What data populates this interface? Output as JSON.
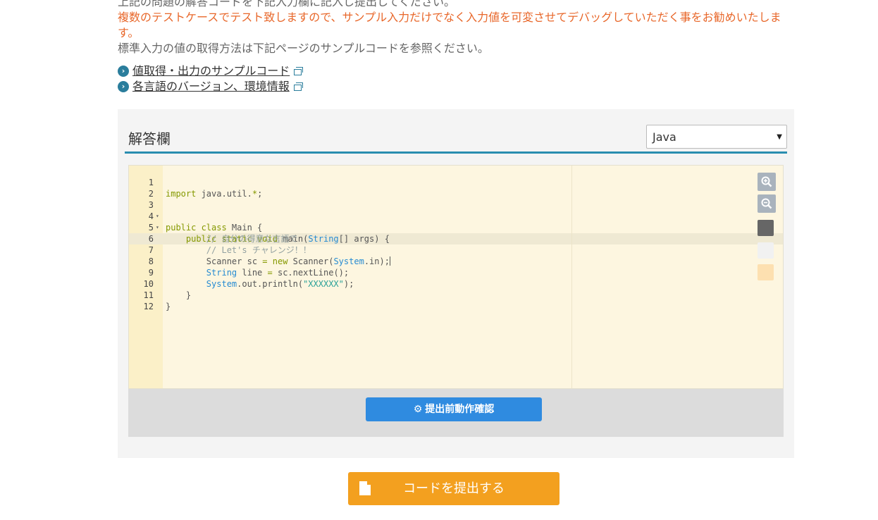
{
  "intro": {
    "line1": "上記の問題の解答コードを下記入力欄に記入し提出してください。",
    "line2": "複数のテストケースでテスト致しますので、サンプル入力だけでなく入力値を可変させてデバッグしていただく事をお勧めいたします。",
    "line3": "標準入力の値の取得方法は下記ページのサンプルコードを参照ください。"
  },
  "links": [
    {
      "label": "値取得・出力のサンプルコード",
      "icon": "external-link-icon"
    },
    {
      "label": "各言語のバージョン、環境情報",
      "icon": "external-link-icon"
    }
  ],
  "answer": {
    "title": "解答欄",
    "language": "Java"
  },
  "editor": {
    "lines": [
      {
        "n": "1",
        "fold": ""
      },
      {
        "n": "2",
        "fold": ""
      },
      {
        "n": "3",
        "fold": "▾"
      },
      {
        "n": "4",
        "fold": "▾"
      },
      {
        "n": "5",
        "fold": ""
      },
      {
        "n": "6",
        "fold": ""
      },
      {
        "n": "7",
        "fold": ""
      },
      {
        "n": "8",
        "fold": ""
      },
      {
        "n": "9",
        "fold": ""
      },
      {
        "n": "10",
        "fold": ""
      },
      {
        "n": "11",
        "fold": ""
      },
      {
        "n": "12",
        "fold": ""
      }
    ],
    "code": {
      "l1_kw": "import",
      "l1_rest": " java.util.",
      "l1_star": "*",
      "l1_end": ";",
      "l3_kw": "public class",
      "l3_rest": " Main {",
      "l4_kw": "public static void",
      "l4_mid": " main(",
      "l4_type": "String",
      "l4_rest": "[] args) {",
      "l5_cm": "// 自分の得意な言語で",
      "l6_cm": "// Let's チャレンジ！！",
      "l7_a": "Scanner sc ",
      "l7_op": "=",
      "l7_new": " new",
      "l7_b": " Scanner(",
      "l7_type": "System",
      "l7_c": ".in);",
      "l8_type": "String",
      "l8_a": " line ",
      "l8_op": "=",
      "l8_b": " sc.nextLine();",
      "l9_type": "System",
      "l9_a": ".out.println(",
      "l9_str": "\"XXXXXX\"",
      "l9_b": ");",
      "l10": "}",
      "l11": "}"
    }
  },
  "buttons": {
    "run_label": "提出前動作確認",
    "submit_label": "コードを提出する"
  },
  "colors": {
    "accent": "#2a8db0",
    "run": "#2f8be0",
    "submit": "#f3a01f",
    "notice": "#e8672a"
  }
}
